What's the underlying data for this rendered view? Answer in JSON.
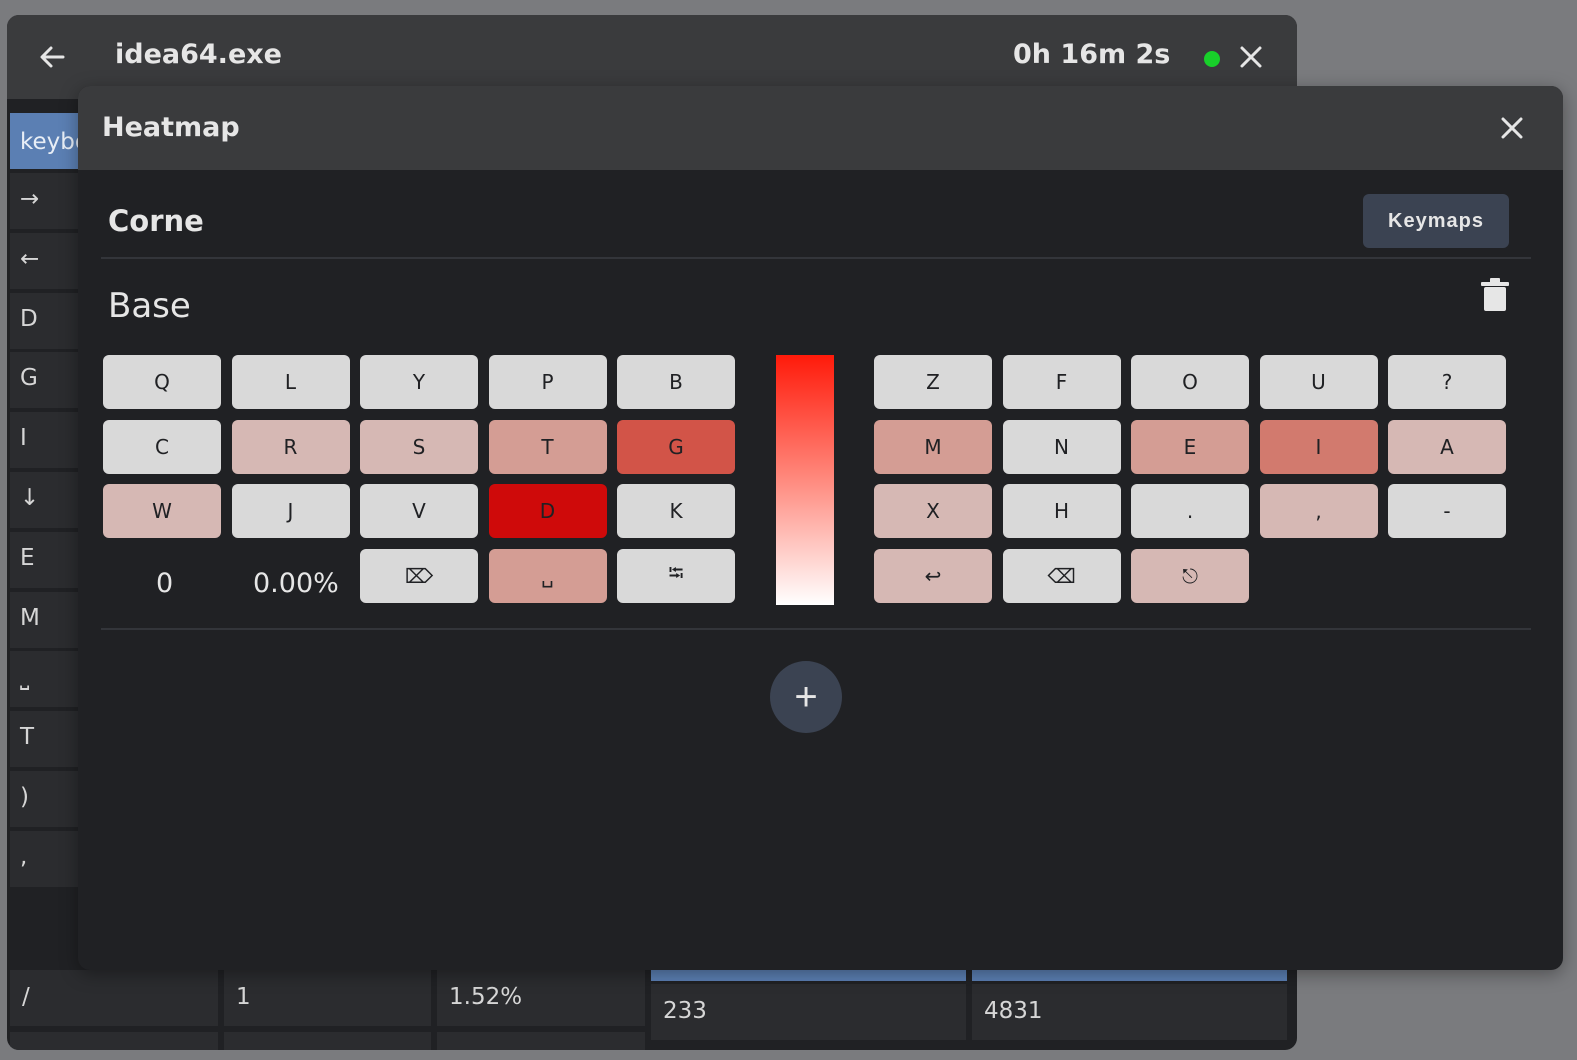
{
  "app": {
    "title": "idea64.exe",
    "timer": "0h 16m 2s",
    "status_color": "#18d02a"
  },
  "sidebar": {
    "header": "keybo",
    "items": [
      "→",
      "←",
      "D",
      "G",
      "I",
      "↓",
      "E",
      "M",
      "⎵",
      "T",
      ")",
      ","
    ]
  },
  "table_bottom": {
    "row": [
      "/",
      "1",
      "1.52%",
      "233",
      "4831"
    ]
  },
  "dialog": {
    "title": "Heatmap",
    "keyboard_name": "Corne",
    "keymaps_label": "Keymaps",
    "layer_name": "Base",
    "stats": {
      "count": "0",
      "percent": "0.00%"
    },
    "left_keys": [
      [
        "Q",
        "L",
        "Y",
        "P",
        "B"
      ],
      [
        "C",
        "R",
        "S",
        "T",
        "G"
      ],
      [
        "W",
        "J",
        "V",
        "D",
        "K"
      ],
      [
        "⌦",
        "␣",
        "⭾"
      ]
    ],
    "right_keys": [
      [
        "Z",
        "F",
        "O",
        "U",
        "?"
      ],
      [
        "M",
        "N",
        "E",
        "I",
        "A"
      ],
      [
        "X",
        "H",
        ".",
        ",",
        "-"
      ],
      [
        "↩",
        "⌫",
        "⎋"
      ]
    ],
    "left_colors": [
      [
        "#d9d9d9",
        "#d9d9d9",
        "#d9d9d9",
        "#d9d9d9",
        "#d9d9d9"
      ],
      [
        "#d9d9d9",
        "#d6b8b4",
        "#d6b8b4",
        "#d49d94",
        "#d25448"
      ],
      [
        "#d6b8b4",
        "#d9d9d9",
        "#d9d9d9",
        "#cf0a0a",
        "#d9d9d9"
      ],
      [
        "#d9d9d9",
        "#d49d94",
        "#d9d9d9"
      ]
    ],
    "right_colors": [
      [
        "#d9d9d9",
        "#d9d9d9",
        "#d9d9d9",
        "#d9d9d9",
        "#d9d9d9"
      ],
      [
        "#d49d94",
        "#d9d9d9",
        "#d49d94",
        "#d27a6e",
        "#d6b8b4"
      ],
      [
        "#d6b8b4",
        "#d9d9d9",
        "#d9d9d9",
        "#d6b8b4",
        "#d9d9d9"
      ],
      [
        "#d6b8b4",
        "#d9d9d9",
        "#d6b8b4"
      ]
    ],
    "add_label": "+"
  }
}
